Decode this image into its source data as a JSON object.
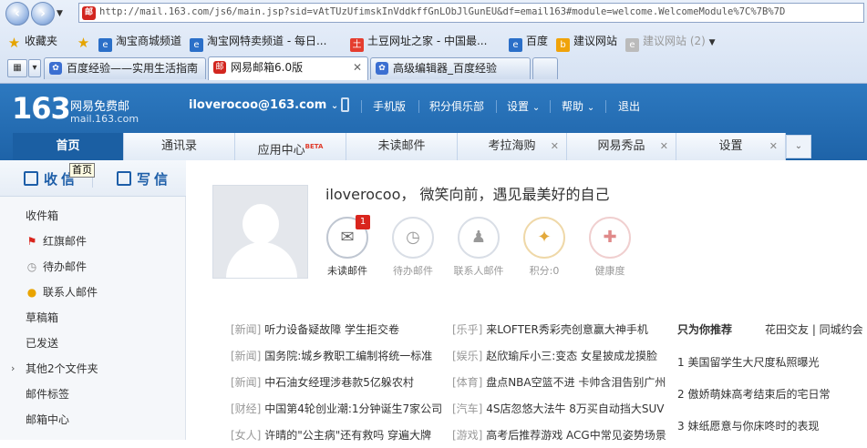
{
  "browser": {
    "url": "http://mail.163.com/js6/main.jsp?sid=vAtTUzUfimskInVddkffGnLObJlGunEU&df=email163#module=welcome.WelcomeModule%7C%7B%7D",
    "favorites_label": "收藏夹",
    "bookmarks": [
      {
        "label": "淘宝商城频道",
        "icon": "ie-icon"
      },
      {
        "label": "淘宝网特卖频道 - 每日...",
        "icon": "ie-icon"
      },
      {
        "label": "土豆网址之家 - 中国最...",
        "icon": "tudou-icon"
      },
      {
        "label": "百度",
        "icon": "ie-icon"
      },
      {
        "label": "建议网站",
        "icon": "bing-icon"
      },
      {
        "label": "建议网站",
        "icon": "ie-icon"
      }
    ],
    "suggest_count": "(2)",
    "tabs": [
      {
        "label": "百度经验——实用生活指南"
      },
      {
        "label": "网易邮箱6.0版"
      },
      {
        "label": "高级编辑器_百度经验"
      }
    ]
  },
  "mail": {
    "logo_num": "163",
    "logo_cn": "网易免费邮",
    "logo_en": "mail.163.com",
    "email": "iloverocoo@163.com",
    "topnav": [
      "手机版",
      "积分俱乐部",
      "设置",
      "帮助",
      "退出"
    ],
    "navtabs": [
      {
        "label": "首页"
      },
      {
        "label": "通讯录"
      },
      {
        "label": "应用中心",
        "badge": "BETA"
      },
      {
        "label": "未读邮件"
      },
      {
        "label": "考拉海购"
      },
      {
        "label": "网易秀品"
      },
      {
        "label": "设置"
      }
    ]
  },
  "sidebar": {
    "receive": "收信",
    "write": "写信",
    "tooltip": "首页",
    "folders": [
      {
        "label": "收件箱",
        "icon": ""
      },
      {
        "label": "红旗邮件",
        "icon": "red-flag-icon"
      },
      {
        "label": "待办邮件",
        "icon": "clock-icon"
      },
      {
        "label": "联系人邮件",
        "icon": "contact-icon"
      },
      {
        "label": "草稿箱",
        "icon": ""
      },
      {
        "label": "已发送",
        "icon": ""
      },
      {
        "label": "其他2个文件夹",
        "icon": "caret"
      },
      {
        "label": "邮件标签",
        "icon": ""
      },
      {
        "label": "邮箱中心",
        "icon": ""
      }
    ]
  },
  "welcome": {
    "greeting": "iloverocoo， 微笑向前，遇见最美好的自己",
    "quick": [
      {
        "label": "未读邮件",
        "badge": "1"
      },
      {
        "label": "待办邮件"
      },
      {
        "label": "联系人邮件"
      },
      {
        "label": "积分:0"
      },
      {
        "label": "健康度"
      }
    ]
  },
  "news": {
    "left": [
      {
        "cat": "[新闻]",
        "text": "听力设备疑故障 学生拒交卷"
      },
      {
        "cat": "[新闻]",
        "text": "国务院:城乡教职工编制将统一标准"
      },
      {
        "cat": "[新闻]",
        "text": "中石油女经理涉巷款5亿躲农村"
      },
      {
        "cat": "[财经]",
        "text": "中国第4轮创业潮:1分钟诞生7家公司"
      },
      {
        "cat": "[女人]",
        "text": "许晴的\"公主病\"还有救吗 穿遍大牌"
      }
    ],
    "right": [
      {
        "cat": "[乐乎]",
        "text": "来LOFTER秀彩壳创意赢大神手机"
      },
      {
        "cat": "[娱乐]",
        "text": "赵欣瑜斥小三:变态 女星披成龙摸脸"
      },
      {
        "cat": "[体育]",
        "text": "盘点NBA空篮不进 卡帅含泪告别广州"
      },
      {
        "cat": "[汽车]",
        "text": "4S店忽悠大法牛 8万买自动挡大SUV"
      },
      {
        "cat": "[游戏]",
        "text": "高考后推荐游戏 ACG中常见姿势场景"
      }
    ]
  },
  "recommend": {
    "title": "只为你推荐",
    "tags": "花田交友 | 同城约会",
    "items": [
      "1 美国留学生大尺度私照曝光",
      "2 傲娇萌妹高考结束后的宅日常",
      "3 妹纸愿意与你床咚时的表现"
    ]
  }
}
